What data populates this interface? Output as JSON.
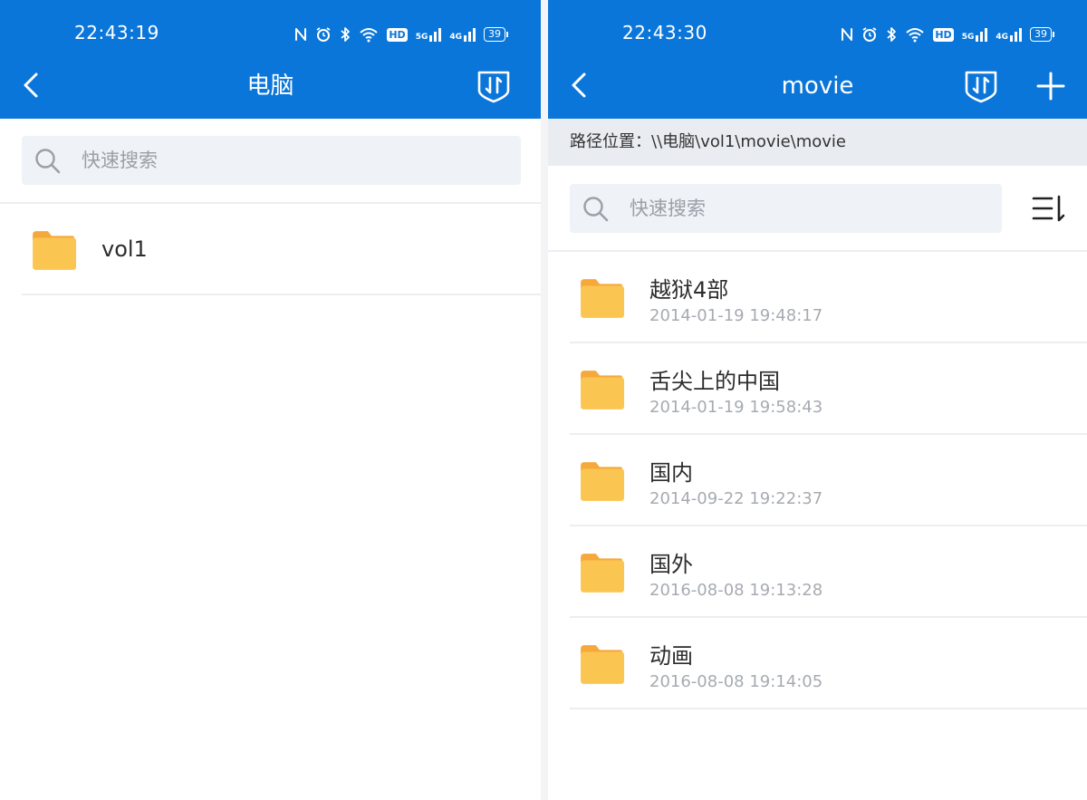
{
  "left_screen": {
    "status_time": "22:43:19",
    "title": "电脑",
    "search_placeholder": "快速搜索",
    "items": [
      {
        "name": "vol1"
      }
    ]
  },
  "right_screen": {
    "status_time": "22:43:30",
    "title": "movie",
    "path_label": "路径位置：\\\\电脑\\vol1\\movie\\movie",
    "search_placeholder": "快速搜索",
    "items": [
      {
        "name": "越狱4部",
        "date": "2014-01-19 19:48:17"
      },
      {
        "name": "舌尖上的中国",
        "date": "2014-01-19 19:58:43"
      },
      {
        "name": "国内",
        "date": "2014-09-22 19:22:37"
      },
      {
        "name": "国外",
        "date": "2016-08-08 19:13:28"
      },
      {
        "name": "动画",
        "date": "2016-08-08 19:14:05"
      }
    ]
  },
  "status_bar": {
    "hd_label": "HD",
    "net_5g": "5G",
    "net_4g": "4G",
    "battery_level": "39",
    "icons": [
      "nfc-icon",
      "alarm-icon",
      "bluetooth-icon",
      "wifi-icon",
      "hd-icon",
      "signal-5g-icon",
      "signal-4g-icon",
      "battery-icon"
    ]
  },
  "colors": {
    "header_blue": "#0b76d9",
    "folder_yellow": "#fbc552",
    "path_bar_bg": "#e9edf2",
    "search_bg": "#eff2f6"
  }
}
